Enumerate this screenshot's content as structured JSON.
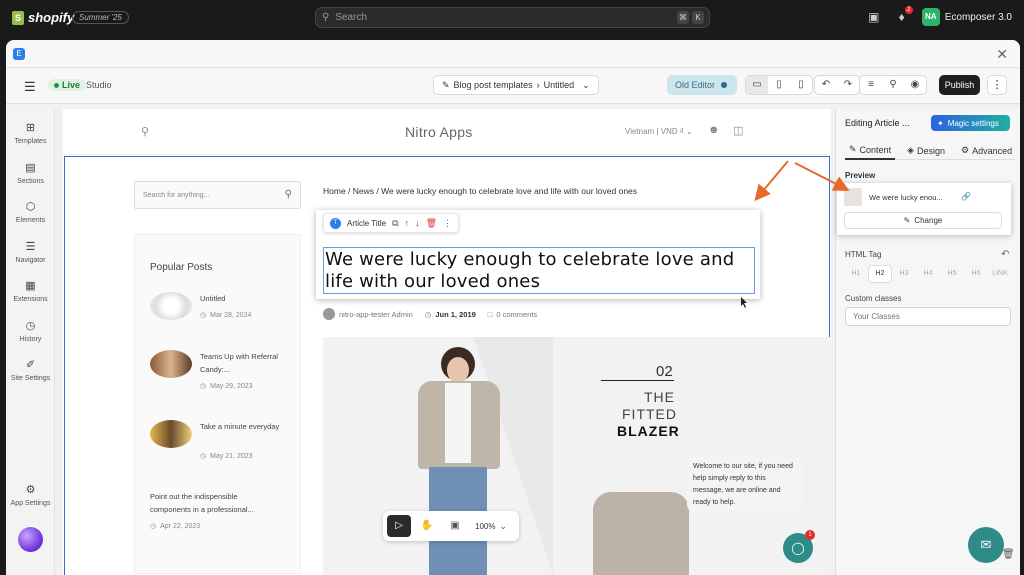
{
  "shopify": {
    "logo_text": "shopify",
    "badge": "Summer '25",
    "search_placeholder": "Search",
    "kbd": [
      "⌘",
      "K"
    ],
    "notification_count": "2",
    "user_initials": "NA",
    "user_app": "Ecomposer 3.0"
  },
  "toolbar": {
    "live_label": "Live",
    "studio_label": "Studio",
    "breadcrumb_parent": "Blog post templates",
    "breadcrumb_current": "Untitled",
    "old_editor_label": "Old Editor",
    "publish_label": "Publish"
  },
  "rail": {
    "items": [
      {
        "label": "Templates",
        "icon": "templates-icon"
      },
      {
        "label": "Sections",
        "icon": "sections-icon"
      },
      {
        "label": "Elements",
        "icon": "elements-icon"
      },
      {
        "label": "Navigator",
        "icon": "navigator-icon"
      },
      {
        "label": "Extensions",
        "icon": "extensions-icon"
      },
      {
        "label": "History",
        "icon": "history-icon"
      },
      {
        "label": "Site Settings",
        "icon": "site-settings-icon"
      }
    ],
    "app_settings_label": "App Settings"
  },
  "store": {
    "title": "Nitro Apps",
    "locale": "Vietnam | VND ₫"
  },
  "blog": {
    "search_placeholder": "Search for anything...",
    "popular_title": "Popular Posts",
    "posts": [
      {
        "title": "Untitled",
        "date": "Mar 28, 2024"
      },
      {
        "title": "Teams Up with Referral Candy:...",
        "date": "May 29, 2023"
      },
      {
        "title": "Take a minute everyday",
        "date": "May 21, 2023"
      },
      {
        "title": "Point out the indispensible components in a professional...",
        "date": "Apr 22, 2023"
      }
    ],
    "breadcrumb": "Home / News / We were lucky enough to celebrate love and life with our loved ones",
    "element_label": "Article Title",
    "article_title": "We were lucky enough to celebrate love and life with our loved ones",
    "author": "nitro-app-tester Admin",
    "date": "Jun 1, 2019",
    "comments": "0 comments",
    "hero": {
      "number": "02",
      "line1": "THE",
      "line2": "FITTED",
      "line3": "BLAZER"
    },
    "chat_message": "Welcome to our site, if you need help simply reply to this message, we are online and ready to help.",
    "chat_badge": "1",
    "zoom": "100%"
  },
  "panel": {
    "title": "Editing Article ...",
    "magic_label": "Magic settings",
    "tabs": [
      "Content",
      "Design",
      "Advanced"
    ],
    "preview_label": "Preview",
    "preview_text": "We were lucky enou...",
    "change_label": "Change",
    "html_tag_label": "HTML Tag",
    "html_tags": [
      "H1",
      "H2",
      "H3",
      "H4",
      "H5",
      "H6",
      "LINK"
    ],
    "selected_tag": "H2",
    "custom_classes_label": "Custom classes",
    "classes_placeholder": "Your Classes"
  },
  "colors": {
    "accent": "#2a7ef0",
    "selection": "#3d68c9",
    "arrow": "#e8692b",
    "chat": "#2e8b88"
  }
}
